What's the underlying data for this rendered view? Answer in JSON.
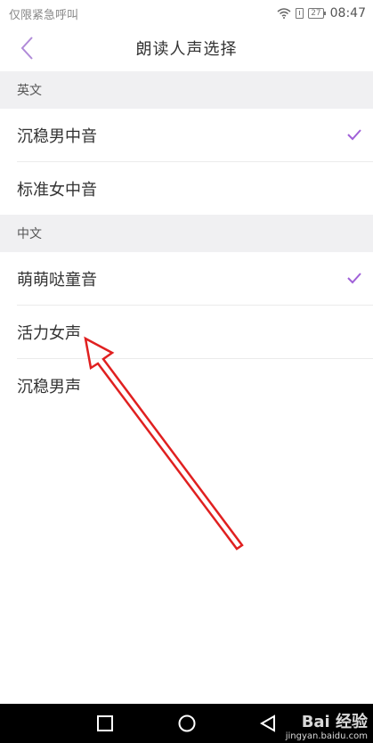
{
  "status_bar": {
    "carrier_text": "仅限紧急呼叫",
    "battery_level": "27",
    "time": "08:47"
  },
  "header": {
    "title": "朗读人声选择",
    "back_icon": "chevron-left-icon"
  },
  "sections": [
    {
      "title": "英文",
      "items": [
        {
          "label": "沉稳男中音",
          "selected": true
        },
        {
          "label": "标准女中音",
          "selected": false
        }
      ]
    },
    {
      "title": "中文",
      "items": [
        {
          "label": "萌萌哒童音",
          "selected": true
        },
        {
          "label": "活力女声",
          "selected": false
        },
        {
          "label": "沉稳男声",
          "selected": false
        }
      ]
    }
  ],
  "nav_bar": {
    "buttons": [
      "back-triangle-icon",
      "home-circle-icon",
      "recents-square-icon"
    ]
  },
  "watermark": {
    "logo": "Bai 经验",
    "url": "jingyan.baidu.com"
  },
  "colors": {
    "accent": "#a060d8",
    "section_bg": "#f0f0f2",
    "annotation": "#e02020",
    "nav_bg": "#000000"
  }
}
